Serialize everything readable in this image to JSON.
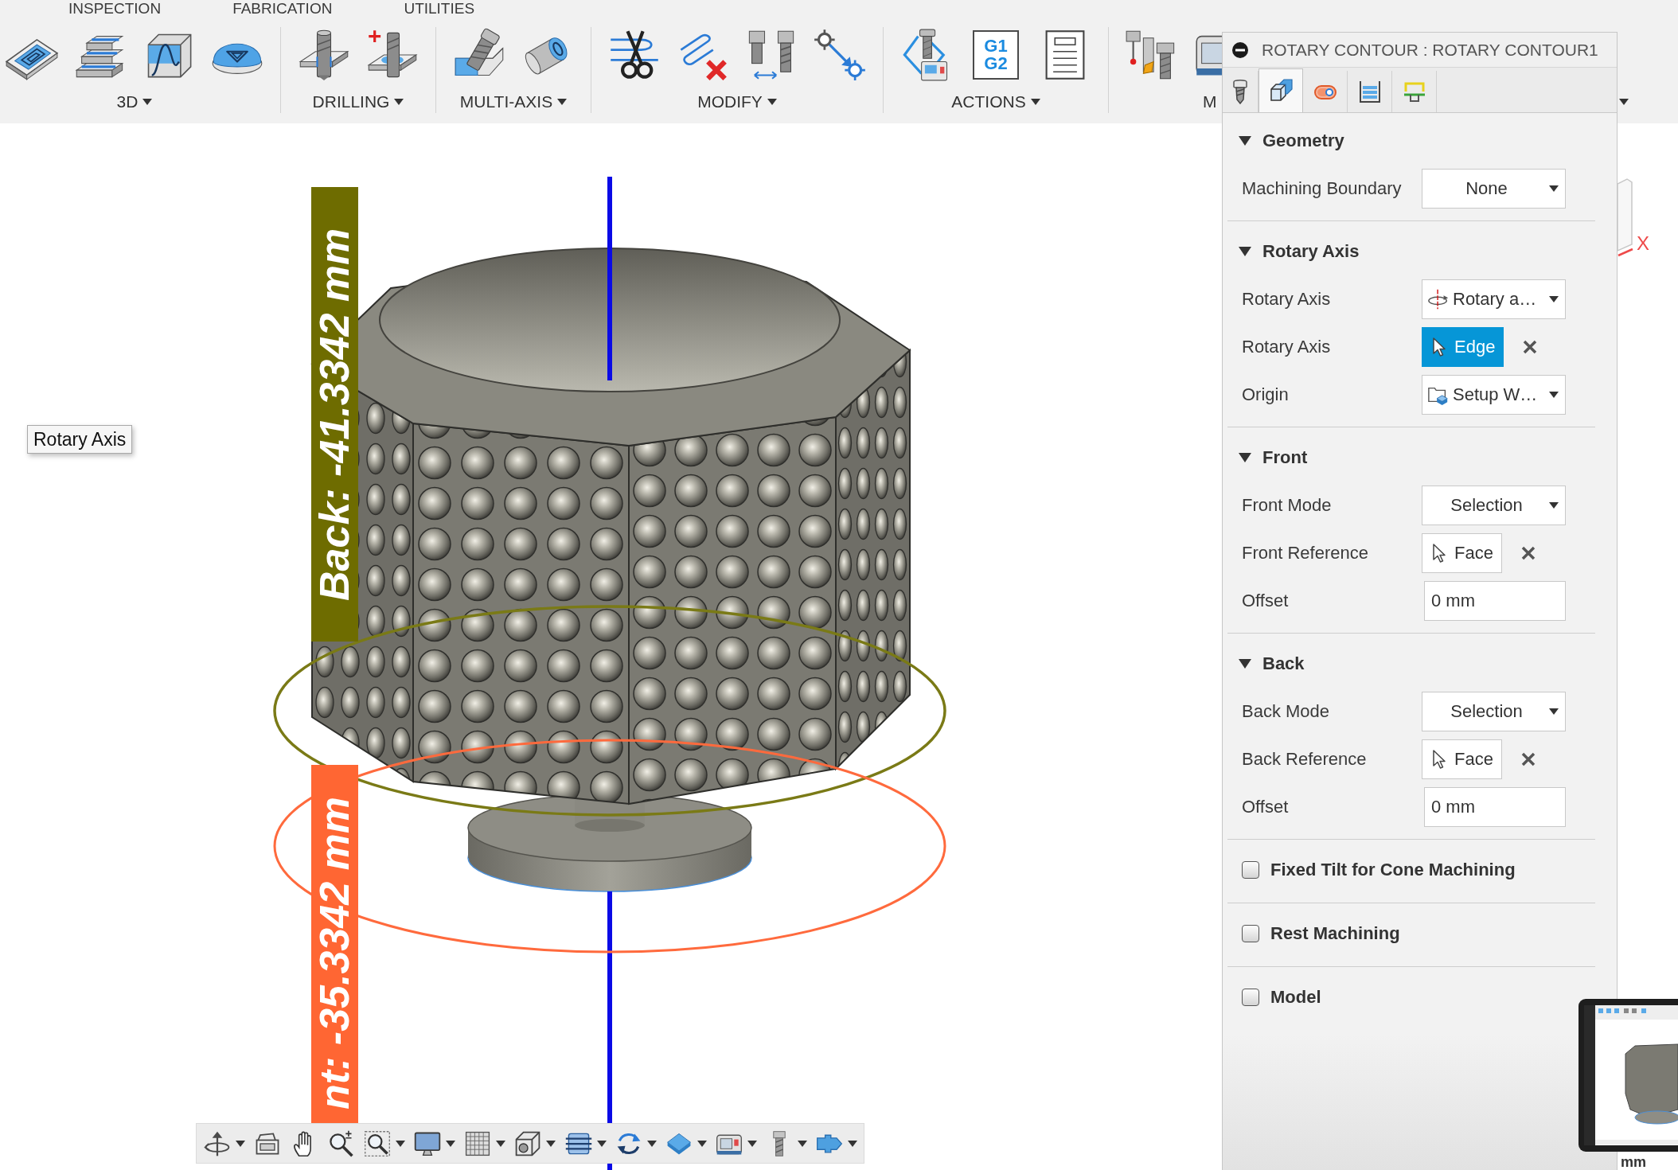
{
  "toolbar": {
    "tabs": [
      {
        "label": "INSPECTION",
        "selected": false
      },
      {
        "label": "FABRICATION",
        "selected": false
      },
      {
        "label": "UTILITIES",
        "selected": false
      }
    ],
    "groups": [
      {
        "label": "3D",
        "menu": true,
        "tools": [
          {
            "kind": "pocket"
          },
          {
            "kind": "steps"
          },
          {
            "kind": "wave"
          },
          {
            "kind": "dome"
          }
        ]
      },
      {
        "label": "DRILLING",
        "menu": true,
        "tools": [
          {
            "kind": "drill"
          },
          {
            "kind": "drilladd"
          }
        ]
      },
      {
        "label": "MULTI-AXIS",
        "menu": true,
        "tools": [
          {
            "kind": "tilted"
          },
          {
            "kind": "cylinder"
          }
        ]
      },
      {
        "label": "MODIFY",
        "menu": true,
        "tools": [
          {
            "kind": "scissors"
          },
          {
            "kind": "pathdelete"
          },
          {
            "kind": "twotools"
          },
          {
            "kind": "nodes"
          }
        ]
      },
      {
        "label": "ACTIONS",
        "menu": true,
        "tools": [
          {
            "kind": "simulate"
          },
          {
            "kind": "post",
            "lines": [
              "G1",
              "G2"
            ]
          },
          {
            "kind": "document"
          }
        ]
      },
      {
        "label": "M",
        "menu": false,
        "tools": [
          {
            "kind": "library"
          },
          {
            "kind": "machine"
          }
        ]
      }
    ],
    "more_menu": true
  },
  "viewport": {
    "tooltip": "Rotary Axis",
    "back_label": "Back: -41.3342 mm",
    "front_label": "nt: -35.3342 mm",
    "axis_label": "X",
    "partial_label": "mm",
    "nav_tools": [
      {
        "kind": "orbit",
        "menu": true
      },
      {
        "kind": "lookat",
        "menu": false
      },
      {
        "kind": "pan",
        "menu": false
      },
      {
        "kind": "zoom",
        "menu": false
      },
      {
        "kind": "zoomwindow",
        "menu": true
      },
      {
        "kind": "display",
        "menu": true
      },
      {
        "kind": "grid",
        "menu": true
      },
      {
        "kind": "viewbox",
        "menu": true
      },
      {
        "kind": "layers",
        "menu": true
      },
      {
        "kind": "refresh",
        "menu": true
      },
      {
        "kind": "diamond",
        "menu": true
      },
      {
        "kind": "machine",
        "menu": true
      },
      {
        "kind": "tool",
        "menu": true
      },
      {
        "kind": "connector",
        "menu": true
      }
    ]
  },
  "panel": {
    "title": "ROTARY CONTOUR : ROTARY CONTOUR1",
    "tabs": [
      {
        "kind": "tool",
        "selected": false
      },
      {
        "kind": "geometry",
        "selected": true
      },
      {
        "kind": "heights",
        "selected": false
      },
      {
        "kind": "passes",
        "selected": false
      },
      {
        "kind": "linking",
        "selected": false
      }
    ],
    "sections": [
      {
        "kind": "group",
        "title": "Geometry",
        "expanded": true,
        "rows": [
          {
            "kind": "dropdown",
            "label": "Machining Boundary",
            "value": "None"
          }
        ]
      },
      {
        "kind": "group",
        "title": "Rotary Axis",
        "expanded": true,
        "rows": [
          {
            "kind": "axis",
            "label": "Rotary Axis",
            "value": "Rotary a…"
          },
          {
            "kind": "selection",
            "label": "Rotary Axis",
            "value": "Edge",
            "selected": true
          },
          {
            "kind": "origin",
            "label": "Origin",
            "value": "Setup W…"
          }
        ]
      },
      {
        "kind": "group",
        "title": "Front",
        "expanded": true,
        "rows": [
          {
            "kind": "dropdown",
            "label": "Front Mode",
            "value": "Selection"
          },
          {
            "kind": "selection",
            "label": "Front Reference",
            "value": "Face",
            "selected": false
          },
          {
            "kind": "number",
            "label": "Offset",
            "value": "0 mm"
          }
        ]
      },
      {
        "kind": "group",
        "title": "Back",
        "expanded": true,
        "rows": [
          {
            "kind": "dropdown",
            "label": "Back Mode",
            "value": "Selection"
          },
          {
            "kind": "selection",
            "label": "Back Reference",
            "value": "Face",
            "selected": false
          },
          {
            "kind": "number",
            "label": "Offset",
            "value": "0 mm"
          }
        ]
      },
      {
        "kind": "toggle",
        "title": "Fixed Tilt for Cone Machining",
        "checked": false
      },
      {
        "kind": "toggle",
        "title": "Rest Machining",
        "checked": false
      },
      {
        "kind": "toggle",
        "title": "Model",
        "checked": false
      }
    ]
  }
}
